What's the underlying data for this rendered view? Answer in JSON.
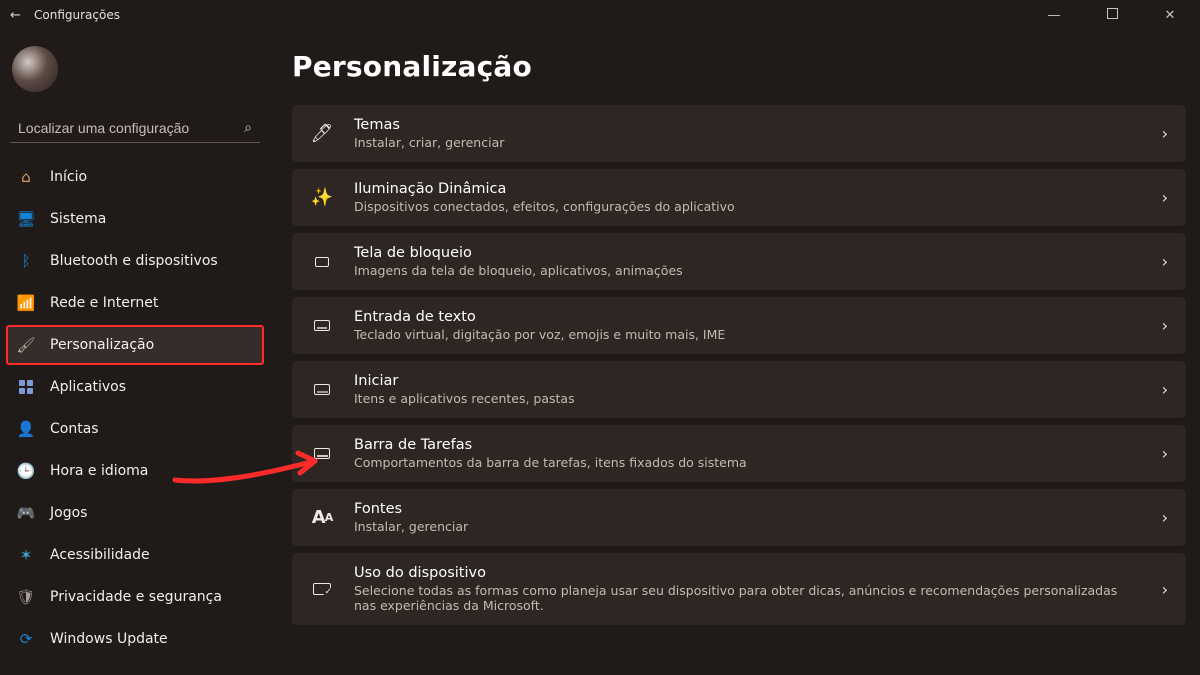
{
  "window": {
    "title": "Configurações"
  },
  "search": {
    "placeholder": "Localizar uma configuração"
  },
  "sidebar": {
    "items": [
      {
        "label": "Início",
        "icon": "home-icon"
      },
      {
        "label": "Sistema",
        "icon": "system-icon"
      },
      {
        "label": "Bluetooth e dispositivos",
        "icon": "bluetooth-icon"
      },
      {
        "label": "Rede e Internet",
        "icon": "wifi-icon"
      },
      {
        "label": "Personalização",
        "icon": "paintbrush-icon",
        "selected": true
      },
      {
        "label": "Aplicativos",
        "icon": "apps-icon"
      },
      {
        "label": "Contas",
        "icon": "user-icon"
      },
      {
        "label": "Hora e idioma",
        "icon": "clock-icon"
      },
      {
        "label": "Jogos",
        "icon": "gamepad-icon"
      },
      {
        "label": "Acessibilidade",
        "icon": "accessibility-icon"
      },
      {
        "label": "Privacidade e segurança",
        "icon": "shield-icon"
      },
      {
        "label": "Windows Update",
        "icon": "update-icon"
      }
    ]
  },
  "page": {
    "title": "Personalização",
    "items": [
      {
        "title": "Temas",
        "desc": "Instalar, criar, gerenciar",
        "icon": "pen-icon"
      },
      {
        "title": "Iluminação Dinâmica",
        "desc": "Dispositivos conectados, efeitos, configurações do aplicativo",
        "icon": "sparkle-icon"
      },
      {
        "title": "Tela de bloqueio",
        "desc": "Imagens da tela de bloqueio, aplicativos, animações",
        "icon": "lockscreen-icon"
      },
      {
        "title": "Entrada de texto",
        "desc": "Teclado virtual, digitação por voz, emojis e muito mais, IME",
        "icon": "keyboard-icon"
      },
      {
        "title": "Iniciar",
        "desc": "Itens e aplicativos recentes, pastas",
        "icon": "start-icon"
      },
      {
        "title": "Barra de Tarefas",
        "desc": "Comportamentos da barra de tarefas, itens fixados do sistema",
        "icon": "taskbar-icon"
      },
      {
        "title": "Fontes",
        "desc": "Instalar, gerenciar",
        "icon": "fonts-icon"
      },
      {
        "title": "Uso do dispositivo",
        "desc": "Selecione todas as formas como planeja usar seu dispositivo para obter dicas, anúncios e recomendações personalizadas nas experiências da Microsoft.",
        "icon": "device-usage-icon"
      }
    ]
  },
  "annotation": {
    "highlighted_sidebar_index": 4,
    "arrow_points_to_item_index": 5
  }
}
